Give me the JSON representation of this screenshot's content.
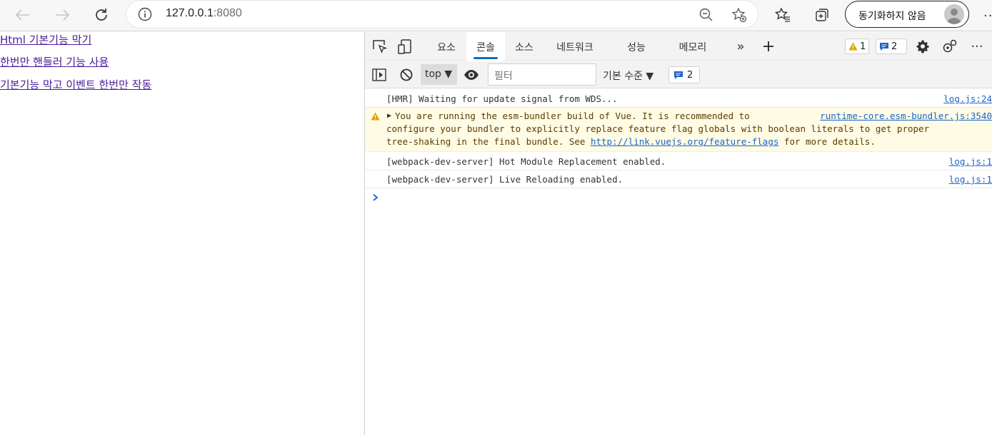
{
  "browser": {
    "url_host": "127.0.0.1",
    "url_port": ":8080",
    "sync_label": "동기화하지 않음",
    "icons": [
      "back-icon",
      "forward-icon",
      "refresh-icon",
      "info-icon",
      "zoom-out-icon",
      "add-favorite-icon",
      "favorites-icon",
      "collections-icon",
      "avatar",
      "more-icon"
    ]
  },
  "page": {
    "links": [
      {
        "label": "Html 기본기능 막기"
      },
      {
        "label": "한번만 핸들러 기능 사용"
      },
      {
        "label": "기본기능 막고 이벤트 한번만 작동"
      }
    ],
    "link_color": "#4b1c99"
  },
  "devtools": {
    "tabs": [
      {
        "label": "요소"
      },
      {
        "label": "콘솔"
      },
      {
        "label": "소스"
      },
      {
        "label": "네트워크"
      },
      {
        "label": "성능"
      },
      {
        "label": "메모리"
      }
    ],
    "active_tab": "콘솔",
    "warning_count": "1",
    "message_count": "2",
    "context": "top",
    "filter_placeholder": "필터",
    "levels_label": "기본 수준 ▼",
    "messages_badge": "2",
    "accent": "#0f6cbd"
  },
  "console": {
    "rows": [
      {
        "type": "log",
        "text": "[HMR] Waiting for update signal from WDS...",
        "source": "log.js:24"
      },
      {
        "type": "warning",
        "text_1": "You are running the esm-bundler build of Vue. It is recommended to",
        "text_2": "configure your bundler to explicitly replace feature flag globals with boolean literals to get proper",
        "text_3": "tree-shaking in the final bundle. See ",
        "link": "http://link.vuejs.org/feature-flags",
        "text_4": " for more details.",
        "source": "runtime-core.esm-bundler.js:3540"
      },
      {
        "type": "log",
        "text": "[webpack-dev-server] Hot Module Replacement enabled.",
        "source": "log.js:1"
      },
      {
        "type": "log",
        "text": "[webpack-dev-server] Live Reloading enabled.",
        "source": "log.js:1"
      }
    ]
  }
}
